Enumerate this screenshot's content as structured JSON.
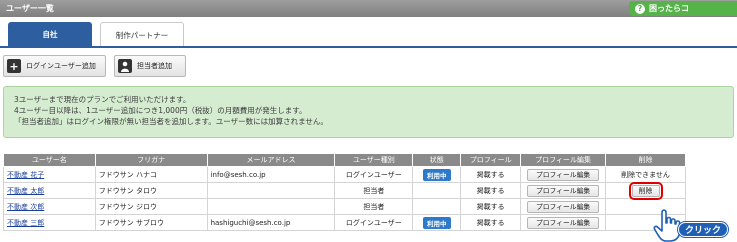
{
  "titlebar": {
    "title": "ユーザー一覧",
    "help_label": "困ったらコ"
  },
  "tabs": [
    {
      "label": "自社",
      "active": true
    },
    {
      "label": "制作パートナー",
      "active": false
    }
  ],
  "actions": {
    "add_login_user": "ログインユーザー追加",
    "add_person": "担当者追加"
  },
  "info": {
    "line1": "3ユーザーまで現在のプランでご利用いただけます。",
    "line2": "4ユーザー目以降は、1ユーザー追加につき1,000円（税抜）の月額費用が発生します。",
    "line3": "「担当者追加」はログイン権限が無い担当者を追加します。ユーザー数には加算されません。"
  },
  "table": {
    "headers": [
      "ユーザー名",
      "フリガナ",
      "メールアドレス",
      "ユーザー種別",
      "状態",
      "プロフィール",
      "プロフィール編集",
      "削除"
    ],
    "rows": [
      {
        "name": "不動産 花子",
        "kana": "フドウサン ハナコ",
        "email": "info@sesh.co.jp",
        "type": "ログインユーザー",
        "status": "利用中",
        "profile": "掲載する",
        "edit": "プロフィール編集",
        "delete": "削除できません"
      },
      {
        "name": "不動産 太郎",
        "kana": "フドウサン タロウ",
        "email": "",
        "type": "担当者",
        "status": "",
        "profile": "掲載する",
        "edit": "プロフィール編集",
        "delete": "削除"
      },
      {
        "name": "不動産 次郎",
        "kana": "フドウサン ジロウ",
        "email": "",
        "type": "担当者",
        "status": "",
        "profile": "掲載する",
        "edit": "プロフィール編集",
        "delete": ""
      },
      {
        "name": "不動産 三郎",
        "kana": "フドウサン サブロウ",
        "email": "hashiguchi@sesh.co.jp",
        "type": "ログインユーザー",
        "status": "利用中",
        "profile": "掲載する",
        "edit": "プロフィール編集",
        "delete": ""
      }
    ]
  },
  "callout": {
    "label": "クリック"
  },
  "colors": {
    "accent": "#2c5ea0",
    "help_green": "#55b34a",
    "info_bg": "#d5ecd0",
    "highlight": "#e00000"
  }
}
